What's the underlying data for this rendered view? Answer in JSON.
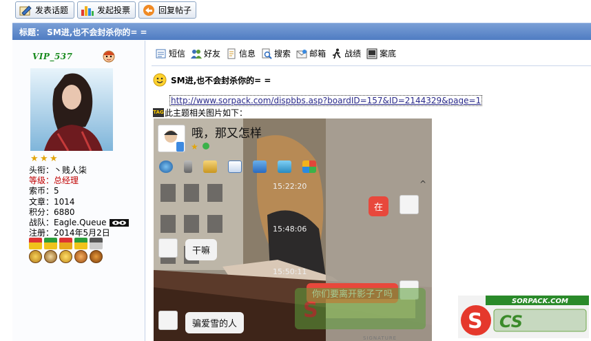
{
  "toolbar": {
    "new_topic": "发表话题",
    "new_poll": "发起投票",
    "reply": "回复帖子"
  },
  "titlebar": {
    "text": "标题： SM进,也不会封杀你的= ="
  },
  "user": {
    "name": "VIP_537",
    "stars": 3,
    "title_label": "头衔：丶贱人柒",
    "level_label": "等级：总经理",
    "coins_label": "索币：5",
    "posts_label": "文章：1014",
    "points_label": "积分：6880",
    "team_label": "战队：Eagle.Queue",
    "register_label": "注册：2014年5月2日"
  },
  "actions": {
    "message": "短信",
    "friend": "好友",
    "info": "信息",
    "search": "搜索",
    "mail": "邮箱",
    "record": "战绩",
    "case": "案底"
  },
  "post": {
    "title": "SM进,也不会封杀你的= =",
    "link": "http://www.sorpack.com/dispbbs.asp?boardID=157&ID=2144329&page=1",
    "image_tag": "TAG",
    "image_caption": "此主题相关图片如下："
  },
  "chat": {
    "contact_name": "哦，那又怎样",
    "ts1": "15:22:20",
    "msg_right1": "在",
    "ts2": "15:48:06",
    "msg_left1": "干嘛",
    "ts3": "15:50:11",
    "msg_right2": "你们要离开影子了吗",
    "msg_left2": "骗爱雪的人",
    "collapse": "^"
  },
  "signature_text": "SIGNATURE",
  "watermark_text": "SORPACK.COM",
  "colors": {
    "titlebar": "#5b86c8",
    "username": "#188a1e",
    "level": "#c00000"
  }
}
